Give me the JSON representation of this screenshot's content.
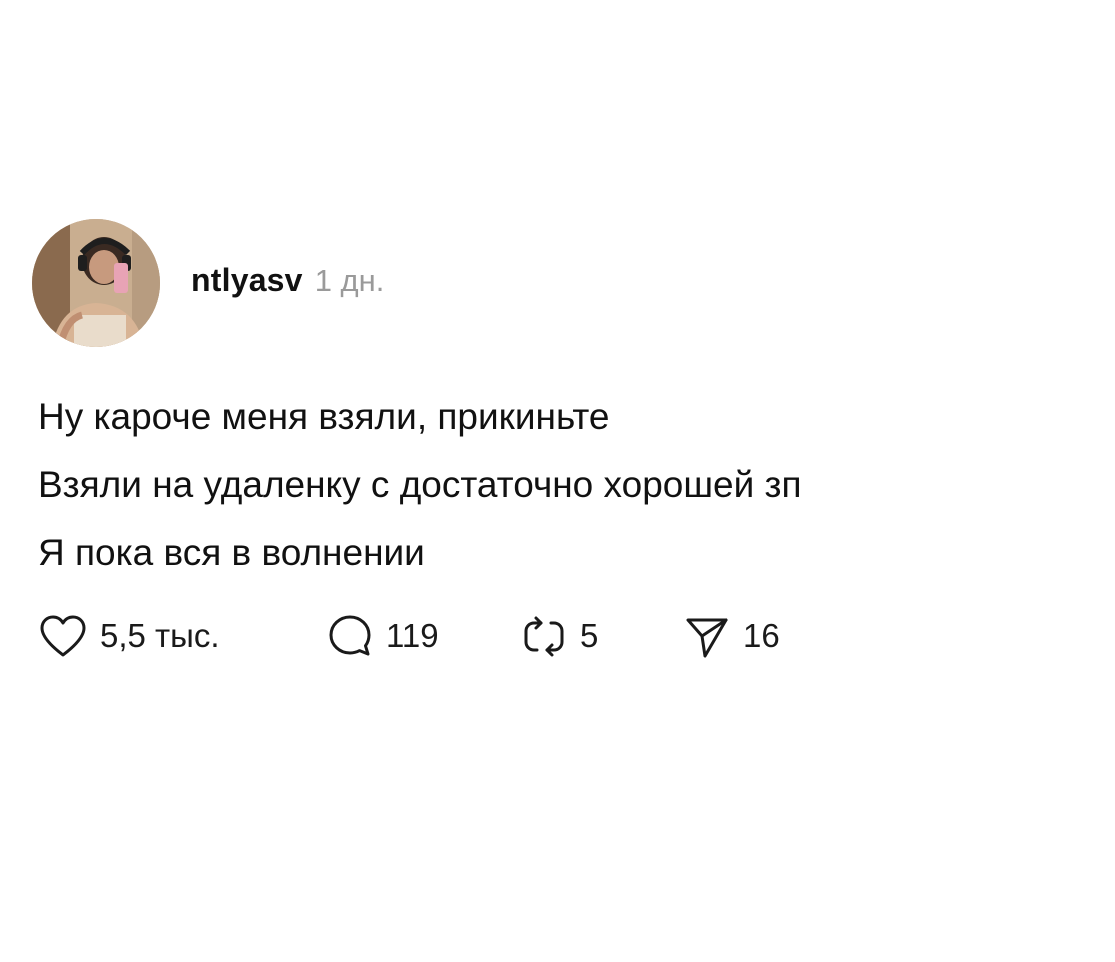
{
  "post": {
    "author": {
      "username": "ntlyasv",
      "time_ago": "1 дн.",
      "avatar_icon": "user-avatar-photo"
    },
    "text_lines": [
      "Ну кароче меня взяли, прикиньте",
      "Взяли на удаленку с достаточно хорошей зп",
      "Я пока вся в волнении"
    ],
    "actions": {
      "likes": {
        "icon": "heart-icon",
        "count": "5,5 тыс."
      },
      "replies": {
        "icon": "comment-icon",
        "count": "119"
      },
      "reposts": {
        "icon": "repost-icon",
        "count": "5"
      },
      "shares": {
        "icon": "send-icon",
        "count": "16"
      }
    }
  },
  "colors": {
    "text": "#111111",
    "muted": "#9a9a9a",
    "background": "#ffffff"
  }
}
